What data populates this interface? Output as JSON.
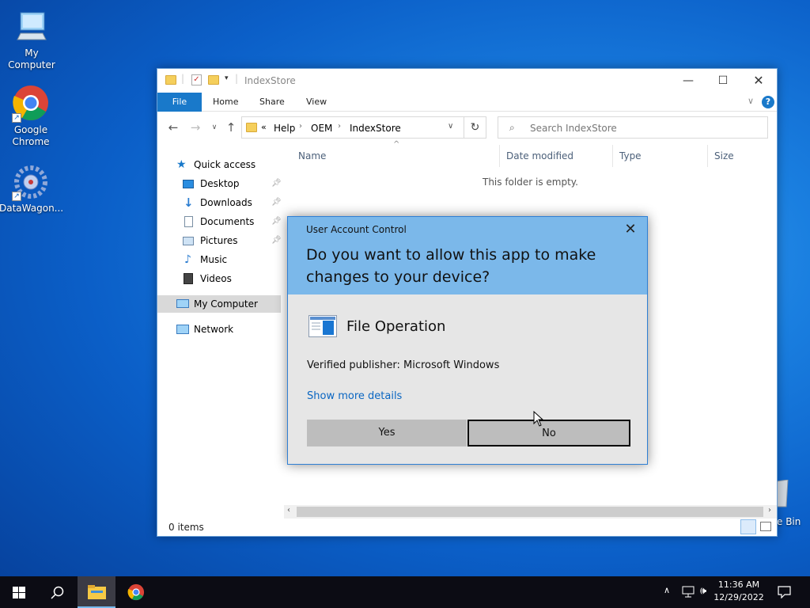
{
  "desktop": {
    "icons": [
      {
        "label": "My Computer",
        "icon": "computer-icon"
      },
      {
        "label": "Google\nChrome",
        "icon": "chrome-icon"
      },
      {
        "label": "DataWagon...",
        "icon": "datawagon-icon"
      }
    ],
    "recycle_bin_partial": "e Bin"
  },
  "explorer": {
    "title": "IndexStore",
    "ribbon_tabs": [
      "File",
      "Home",
      "Share",
      "View"
    ],
    "breadcrumb": [
      "«",
      "Help",
      "OEM",
      "IndexStore"
    ],
    "search_placeholder": "Search IndexStore",
    "nav": {
      "quick_access": "Quick access",
      "items": [
        {
          "label": "Desktop",
          "pinned": true
        },
        {
          "label": "Downloads",
          "pinned": true
        },
        {
          "label": "Documents",
          "pinned": true
        },
        {
          "label": "Pictures",
          "pinned": true
        },
        {
          "label": "Music",
          "pinned": false
        },
        {
          "label": "Videos",
          "pinned": false
        }
      ],
      "my_computer": "My Computer",
      "network": "Network"
    },
    "columns": [
      "Name",
      "Date modified",
      "Type",
      "Size"
    ],
    "empty_message": "This folder is empty.",
    "status": "0 items"
  },
  "uac": {
    "title": "User Account Control",
    "question": "Do you want to allow this app to make changes to your device?",
    "app_name": "File Operation",
    "publisher": "Verified publisher: Microsoft Windows",
    "details_link": "Show more details",
    "yes_label": "Yes",
    "no_label": "No",
    "header_color": "#7bb8ea"
  },
  "taskbar": {
    "time": "11:36 AM",
    "date": "12/29/2022",
    "pinned": [
      "start-icon",
      "search-icon",
      "file-explorer-icon",
      "chrome-icon"
    ]
  }
}
